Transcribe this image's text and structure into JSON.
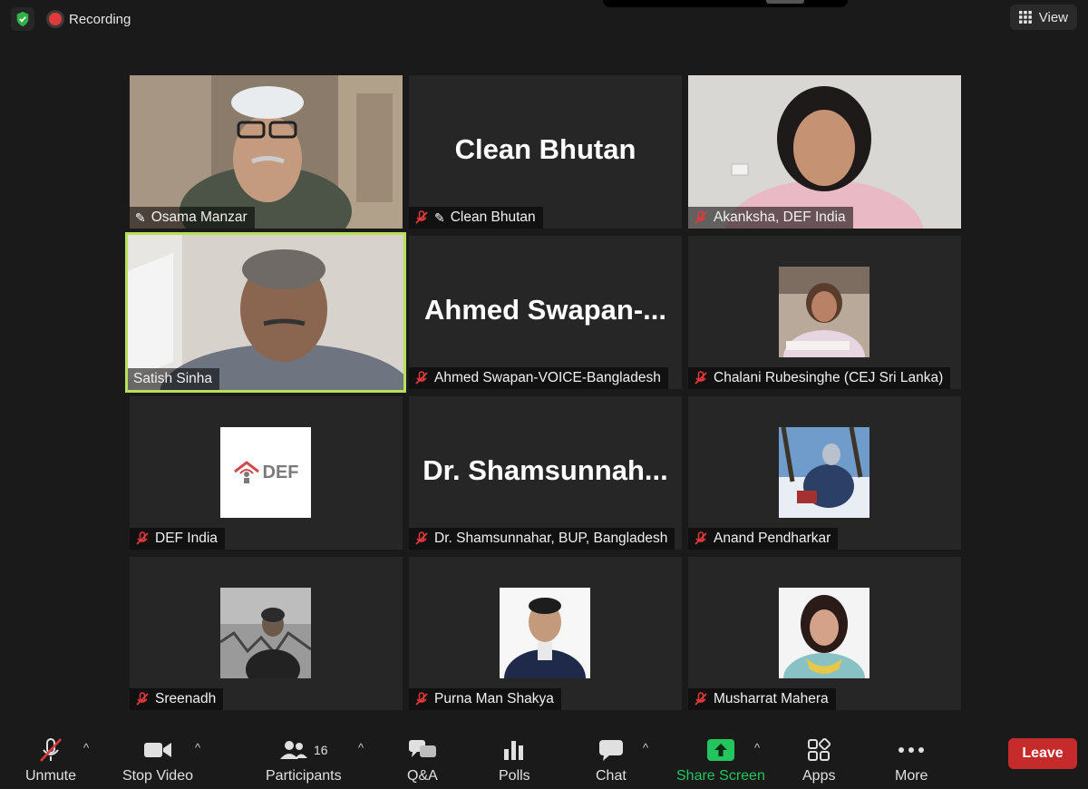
{
  "topbar": {
    "recording_label": "Recording",
    "view_label": "View"
  },
  "tiles": [
    {
      "name": "Osama Manzar"
    },
    {
      "name": "Clean Bhutan",
      "big": "Clean Bhutan"
    },
    {
      "name": "Akanksha, DEF India"
    },
    {
      "name": "Satish Sinha"
    },
    {
      "name": "Ahmed Swapan-VOICE-Bangladesh",
      "big": "Ahmed  Swapan-..."
    },
    {
      "name": "Chalani Rubesinghe (CEJ Sri Lanka)"
    },
    {
      "name": "DEF India",
      "logo_text": "DEF"
    },
    {
      "name": "Dr. Shamsunnahar, BUP, Bangladesh",
      "big": "Dr.  Shamsunnah..."
    },
    {
      "name": "Anand Pendharkar"
    },
    {
      "name": "Sreenadh"
    },
    {
      "name": "Purna Man Shakya"
    },
    {
      "name": "Musharrat Mahera"
    }
  ],
  "toolbar": {
    "unmute": "Unmute",
    "stop_video": "Stop Video",
    "participants": "Participants",
    "participants_count": "16",
    "qa": "Q&A",
    "polls": "Polls",
    "chat": "Chat",
    "share_screen": "Share Screen",
    "apps": "Apps",
    "more": "More",
    "leave": "Leave"
  },
  "colors": {
    "active_speaker": "#b8e05a",
    "share_green": "#22c55e",
    "leave_red": "#c52b2b",
    "muted_red": "#e23a3a"
  }
}
